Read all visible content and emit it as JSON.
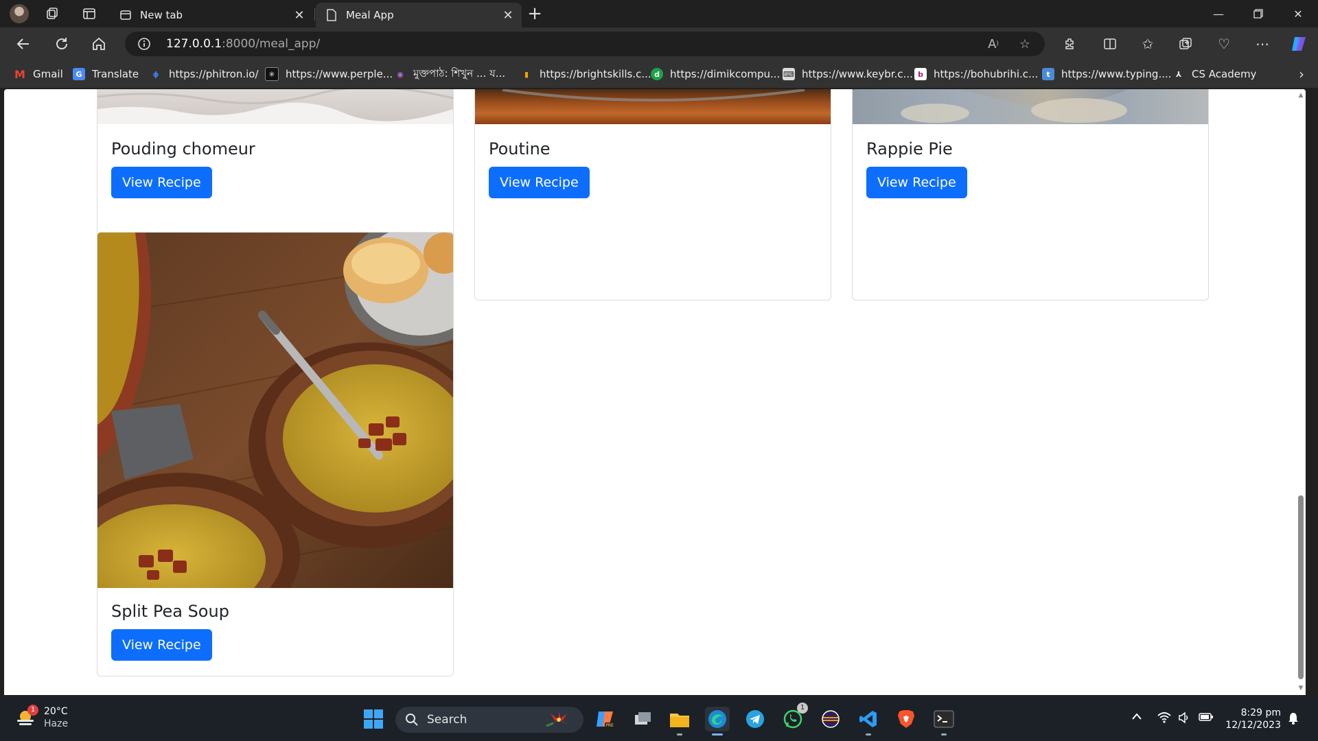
{
  "browser": {
    "tabs": [
      {
        "label": "New tab",
        "active": false
      },
      {
        "label": "Meal App",
        "active": true
      }
    ],
    "address": {
      "host": "127.0.0.1",
      "rest": ":8000/meal_app/"
    },
    "bookmarks": [
      {
        "label": "Gmail",
        "icon": "gmail-icon"
      },
      {
        "label": "Translate",
        "icon": "translate-icon"
      },
      {
        "label": "https://phitron.io/",
        "icon": "phitron-icon"
      },
      {
        "label": "https://www.perple...",
        "icon": "perplexity-icon"
      },
      {
        "label": "মুক্তপাঠ: শিখুন ... য...",
        "icon": "muktopaath-icon"
      },
      {
        "label": "https://brightskills.c...",
        "icon": "brightskills-icon"
      },
      {
        "label": "https://dimikcompu...",
        "icon": "dimik-icon"
      },
      {
        "label": "https://www.keybr.c...",
        "icon": "keybr-icon"
      },
      {
        "label": "https://bohubrihi.c...",
        "icon": "bohubrihi-icon"
      },
      {
        "label": "https://www.typing....",
        "icon": "typing-icon"
      },
      {
        "label": "CS Academy",
        "icon": "csacademy-icon"
      }
    ]
  },
  "meals": [
    {
      "name": "Pouding chomeur",
      "button": "View Recipe"
    },
    {
      "name": "Poutine",
      "button": "View Recipe"
    },
    {
      "name": "Rappie Pie",
      "button": "View Recipe"
    },
    {
      "name": "Split Pea Soup",
      "button": "View Recipe"
    }
  ],
  "taskbar": {
    "weather": {
      "temp": "20°C",
      "condition": "Haze",
      "badge": "1"
    },
    "search_label": "Search",
    "whatsapp_badge": "1",
    "time": "8:29 pm",
    "date": "12/12/2023"
  },
  "colors": {
    "primary": "#0d6efd",
    "browser_dark": "#202020",
    "toolbar": "#323232"
  }
}
